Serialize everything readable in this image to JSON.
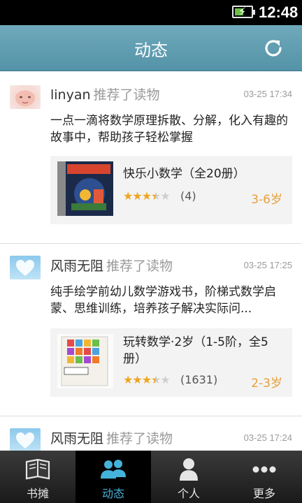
{
  "status_bar": {
    "time": "12:48",
    "battery_level": 0.55,
    "charging": true
  },
  "header": {
    "title": "动态",
    "refresh_icon": "refresh-icon"
  },
  "colors": {
    "header": "#5f9eb2",
    "accent": "#45b2da",
    "age": "#e6a03a",
    "star": "#f0a51e"
  },
  "feed": [
    {
      "user": "linyan",
      "action": "推荐了读物",
      "time": "03-25 17:34",
      "avatar": "baby-photo",
      "desc": "一点一滴将数学原理拆散、分解，化入有趣的故事中，帮助孩子轻松掌握",
      "book": {
        "title": "快乐小数学（全20册）",
        "rating": 3.5,
        "rating_count": "(4)",
        "age": "3-6岁"
      }
    },
    {
      "user": "风雨无阻",
      "action": "推荐了读物",
      "time": "03-25 17:25",
      "avatar": "heart-icon",
      "desc": "纯手绘学前幼儿数学游戏书，阶梯式数学启蒙、思维训练，培养孩子解决实际问...",
      "book": {
        "title": "玩转数学·2岁（1-5阶，全5册）",
        "rating": 3.5,
        "rating_count": "(1631)",
        "age": "2-3岁"
      }
    },
    {
      "user": "风雨无阻",
      "action": "推荐了读物",
      "time": "03-25 17:24",
      "avatar": "heart-icon"
    }
  ],
  "nav": [
    {
      "label": "书摊",
      "icon": "bookstand-icon",
      "active": false
    },
    {
      "label": "动态",
      "icon": "people-icon",
      "active": true
    },
    {
      "label": "个人",
      "icon": "person-icon",
      "active": false
    },
    {
      "label": "更多",
      "icon": "more-icon",
      "active": false
    }
  ]
}
